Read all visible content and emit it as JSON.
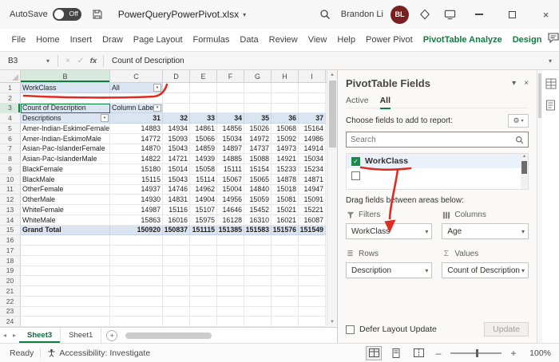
{
  "icons": {
    "chevron": "▾",
    "dropdown": "▾",
    "close": "×",
    "check": "✓",
    "cancel": "×",
    "sigma": "Σ",
    "rows_glyph": "≣",
    "up_arrow": "▲",
    "down_arrow": "▼",
    "left_arrow": "◂",
    "right_arrow": "▸",
    "plus": "+",
    "minus": "–",
    "gear": "⚙"
  },
  "title_bar": {
    "autosave_label": "AutoSave",
    "autosave_state": "Off",
    "filename": "PowerQueryPowerPivot.xlsx",
    "user_name": "Brandon Li",
    "user_initials": "BL"
  },
  "ribbon": {
    "tabs": [
      {
        "label": "File",
        "accent": false
      },
      {
        "label": "Home",
        "accent": false
      },
      {
        "label": "Insert",
        "accent": false
      },
      {
        "label": "Draw",
        "accent": false
      },
      {
        "label": "Page Layout",
        "accent": false
      },
      {
        "label": "Formulas",
        "accent": false
      },
      {
        "label": "Data",
        "accent": false
      },
      {
        "label": "Review",
        "accent": false
      },
      {
        "label": "View",
        "accent": false
      },
      {
        "label": "Help",
        "accent": false
      },
      {
        "label": "Power Pivot",
        "accent": false
      },
      {
        "label": "PivotTable Analyze",
        "accent": true
      },
      {
        "label": "Design",
        "accent": true
      }
    ]
  },
  "formula_bar": {
    "name_box": "B3",
    "fx_label": "fx",
    "content": "Count of Description"
  },
  "sheet": {
    "columns": [
      "B",
      "C",
      "D",
      "E",
      "F",
      "G",
      "H",
      "I"
    ],
    "row_count": 24,
    "pivot": {
      "filter_label": "WorkClass",
      "filter_value": "All",
      "values_label": "Count of Description",
      "column_labels_caption": "Column Labels",
      "row_header": "Descriptions",
      "ages": [
        "31",
        "32",
        "33",
        "34",
        "35",
        "36",
        "37"
      ],
      "rows": [
        {
          "label": "Amer-Indian-EskimoFemale",
          "values": [
            14883,
            14934,
            14861,
            14856,
            15026,
            15068,
            15164
          ]
        },
        {
          "label": "Amer-Indian-EskimoMale",
          "values": [
            14772,
            15093,
            15066,
            15034,
            14972,
            15092,
            14986
          ]
        },
        {
          "label": "Asian-Pac-IslanderFemale",
          "values": [
            14870,
            15043,
            14859,
            14897,
            14737,
            14973,
            14914
          ]
        },
        {
          "label": "Asian-Pac-IslanderMale",
          "values": [
            14822,
            14721,
            14939,
            14885,
            15088,
            14921,
            15034
          ]
        },
        {
          "label": "BlackFemale",
          "values": [
            15180,
            15014,
            15058,
            15111,
            15154,
            15233,
            15234
          ]
        },
        {
          "label": "BlackMale",
          "values": [
            15115,
            15043,
            15114,
            15067,
            15065,
            14878,
            14871
          ]
        },
        {
          "label": "OtherFemale",
          "values": [
            14937,
            14746,
            14962,
            15004,
            14840,
            15018,
            14947
          ]
        },
        {
          "label": "OtherMale",
          "values": [
            14930,
            14831,
            14904,
            14956,
            15059,
            15081,
            15091
          ]
        },
        {
          "label": "WhiteFemale",
          "values": [
            14987,
            15116,
            15107,
            14646,
            15452,
            15021,
            15221
          ]
        },
        {
          "label": "WhiteMale",
          "values": [
            15863,
            16016,
            15975,
            16128,
            16310,
            16021,
            16087
          ]
        }
      ],
      "grand_total": {
        "label": "Grand Total",
        "values": [
          150920,
          150837,
          151115,
          151385,
          151583,
          151576,
          151549
        ]
      }
    },
    "tabs": [
      "Sheet3",
      "Sheet1"
    ],
    "active_tab": "Sheet3"
  },
  "fields_pane": {
    "title": "PivotTable Fields",
    "tabs": [
      "Active",
      "All"
    ],
    "active_tab": "All",
    "choose_label": "Choose fields to add to report:",
    "search_placeholder": "Search",
    "fields": [
      {
        "name": "WorkClass",
        "checked": true
      }
    ],
    "drag_label": "Drag fields between areas below:",
    "areas": {
      "filters": {
        "label": "Filters",
        "items": [
          "WorkClass"
        ]
      },
      "columns": {
        "label": "Columns",
        "items": [
          "Age"
        ]
      },
      "rows": {
        "label": "Rows",
        "items": [
          "Description"
        ]
      },
      "values": {
        "label": "Values",
        "items": [
          "Count of Description"
        ]
      }
    },
    "defer_label": "Defer Layout Update",
    "update_label": "Update"
  },
  "status_bar": {
    "ready": "Ready",
    "accessibility": "Accessibility: Investigate",
    "zoom": "100%"
  },
  "colors": {
    "accent_green": "#107C41",
    "annotation_red": "#E02B20",
    "pivot_header_bg": "#DBE5F2",
    "avatar_bg": "#7A1F1F"
  }
}
